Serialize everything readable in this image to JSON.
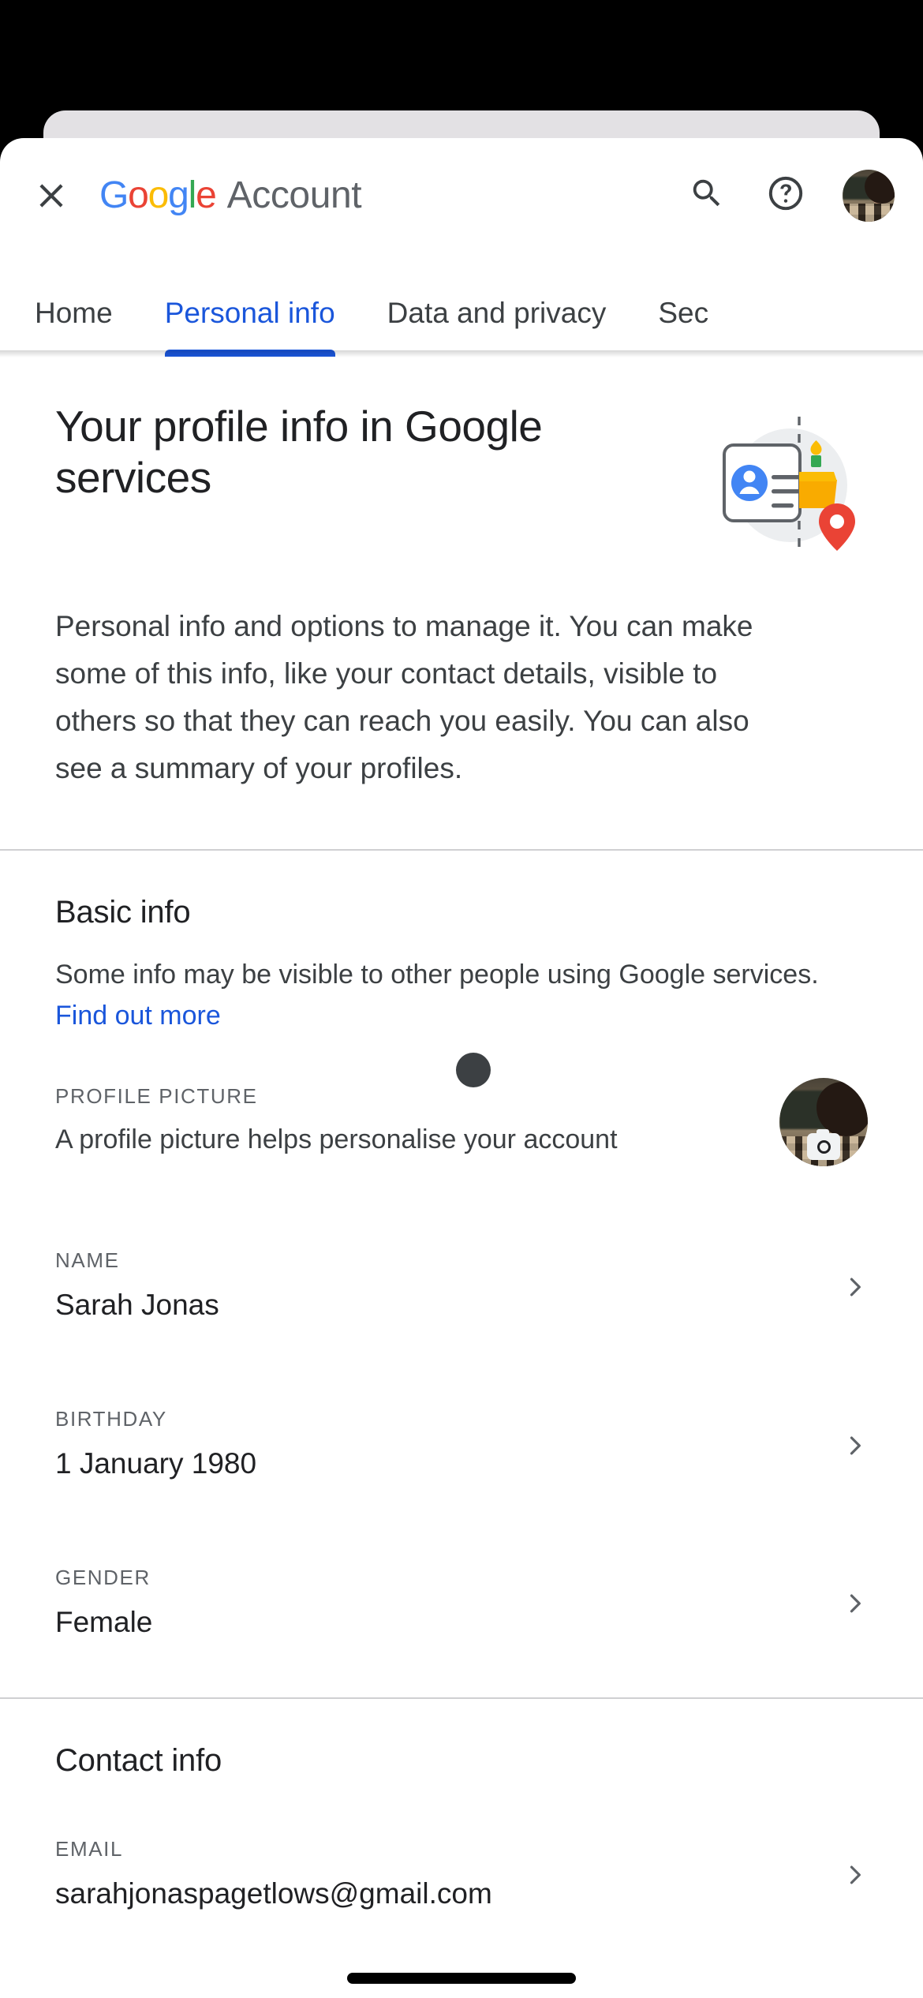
{
  "appbar": {
    "close_icon": "close-icon",
    "logo_letters": [
      {
        "ch": "G",
        "color": "#4285F4"
      },
      {
        "ch": "o",
        "color": "#EA4335"
      },
      {
        "ch": "o",
        "color": "#FBBC05"
      },
      {
        "ch": "g",
        "color": "#4285F4"
      },
      {
        "ch": "l",
        "color": "#34A853"
      },
      {
        "ch": "e",
        "color": "#EA4335"
      }
    ],
    "product_name": "Account",
    "search_icon": "search-icon",
    "help_icon": "help-circle-icon",
    "avatar_label": "Google Account: Sarah Jonas"
  },
  "tabs": [
    {
      "label": "Home",
      "active": false
    },
    {
      "label": "Personal info",
      "active": true
    },
    {
      "label": "Data and privacy",
      "active": false
    },
    {
      "label": "Sec",
      "active": false
    }
  ],
  "hero": {
    "title": "Your profile info in Google services",
    "description": "Personal info and options to manage it. You can make some of this info, like your contact details, visible to others so that they can reach you easily. You can also see a summary of your profiles.",
    "illustration": "profile-card-cake-pin-illustration"
  },
  "basic_info": {
    "heading": "Basic info",
    "subtitle_text": "Some info may be visible to other people using Google services. ",
    "subtitle_link": "Find out more",
    "rows": [
      {
        "label": "PROFILE PICTURE",
        "description": "A profile picture helps personalise your account",
        "type": "avatar",
        "camera_icon": "camera-icon"
      },
      {
        "label": "NAME",
        "value": "Sarah Jonas",
        "type": "value",
        "chevron": "chevron-right-icon"
      },
      {
        "label": "BIRTHDAY",
        "value": "1 January 1980",
        "type": "value",
        "chevron": "chevron-right-icon"
      },
      {
        "label": "GENDER",
        "value": "Female",
        "type": "value",
        "chevron": "chevron-right-icon"
      }
    ]
  },
  "contact_info": {
    "heading": "Contact info",
    "rows": [
      {
        "label": "EMAIL",
        "value": "sarahjonaspagetlows@gmail.com",
        "chevron": "chevron-right-icon"
      }
    ]
  },
  "colors": {
    "accent_blue": "#1a56db",
    "text_primary": "#202124",
    "text_secondary": "#3c4043",
    "text_muted": "#5f6368",
    "divider": "#cfd0d2",
    "card_behind": "#e3e1e4",
    "backdrop": "#000000"
  }
}
